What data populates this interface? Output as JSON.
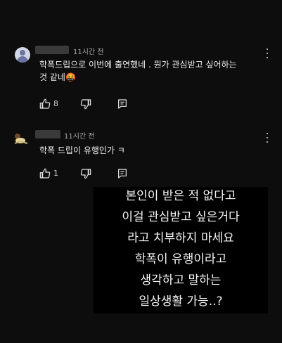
{
  "comments": [
    {
      "time": "11시간 전",
      "line1": "학폭드립으로  이번에 출연했네 . 뭔가 관심받고 싶어하는",
      "line2": "것 같네",
      "emoji": "🤬",
      "likes": "8",
      "avatar_icon": "default-avatar-icon"
    },
    {
      "time": "11시간 전",
      "line1": "학폭 드립이 유행인가 ㅋ",
      "likes": "1",
      "avatar_icon": "user-avatar-icon"
    }
  ],
  "overlay": {
    "lines": [
      "본인이 받은 적 없다고",
      "이걸 관심받고 싶은거다",
      "라고 치부하지 마세요",
      "학폭이 유행이라고",
      "생각하고 말하는",
      "일상생활 가능..?"
    ]
  },
  "colors": {
    "background": "#0d0d0d",
    "overlay": "#000000",
    "text": "#eeeeee",
    "meta": "#aaaaaa"
  }
}
